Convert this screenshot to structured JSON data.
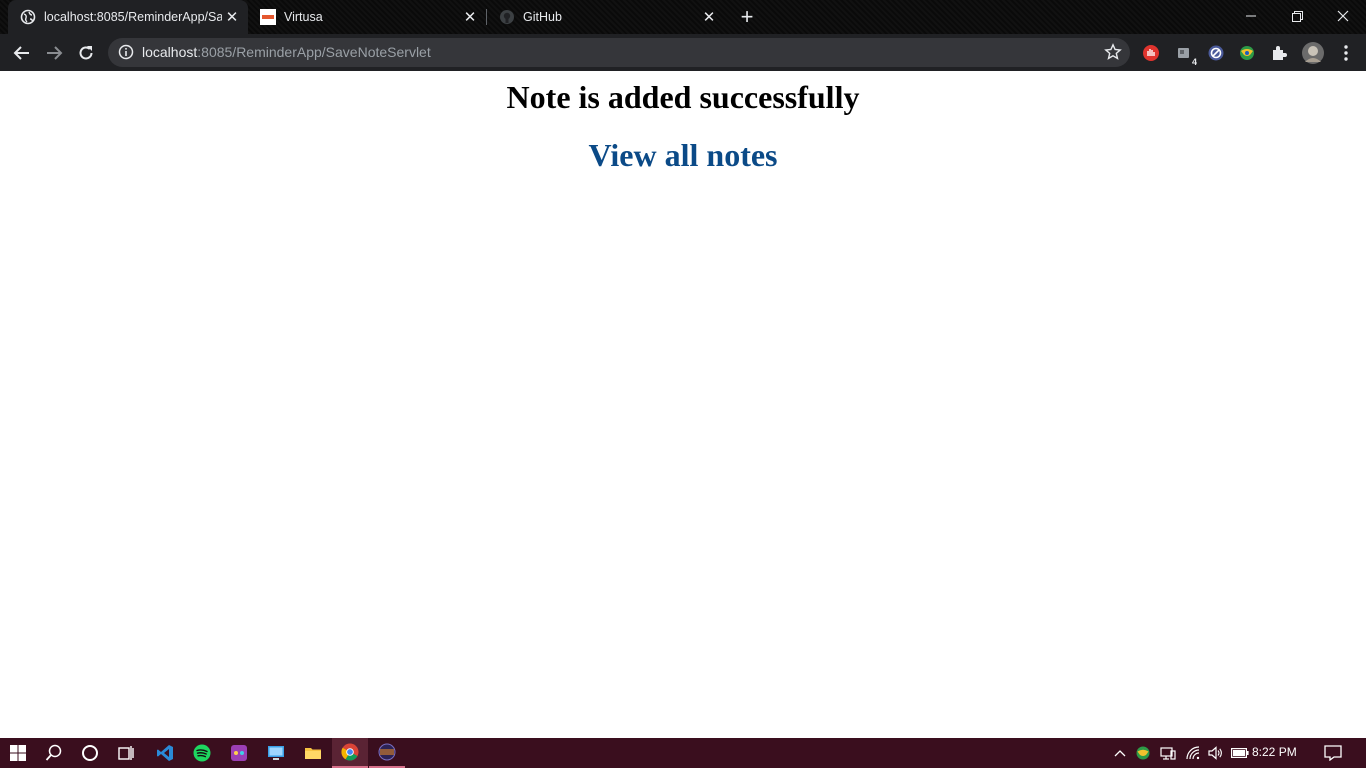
{
  "browser": {
    "tabs": [
      {
        "title": "localhost:8085/ReminderApp/SaveNoteServlet",
        "favicon": "globe-icon",
        "active": true
      },
      {
        "title": "Virtusa",
        "favicon": "virtusa-logo-icon",
        "active": false
      },
      {
        "title": "GitHub",
        "favicon": "github-icon",
        "active": false
      }
    ],
    "address_bar": {
      "host": "localhost",
      "rest": ":8085/ReminderApp/SaveNoteServlet"
    },
    "extension_badge": "4"
  },
  "page": {
    "message": "Note is added successfully",
    "link_text": "View all notes"
  },
  "taskbar": {
    "time": "8:22 PM"
  },
  "colors": {
    "link": "#0b4a87",
    "taskbar": "#3a0e1e",
    "chrome_dark": "#202124"
  }
}
